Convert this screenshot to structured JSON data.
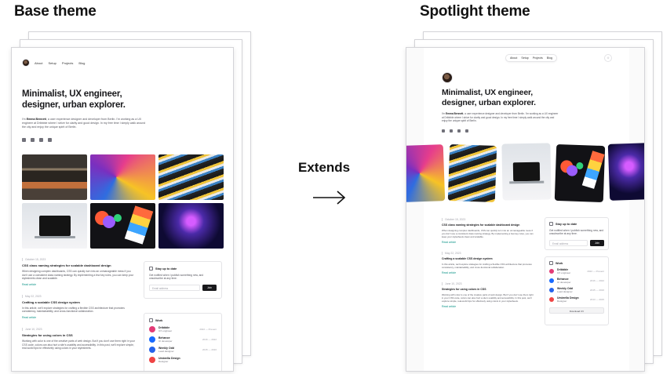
{
  "headings": {
    "base": "Base theme",
    "spotlight": "Spotlight theme",
    "relation": "Extends",
    "arrow_glyph": "→"
  },
  "site": {
    "nav": [
      "About",
      "Setup",
      "Projects",
      "Blog"
    ],
    "title": "Minimalist, UX engineer, designer, urban explorer.",
    "intro_prefix": "I'm ",
    "intro_name": "Emma Bennett",
    "intro_rest": ", a user experience designer and developer from Berlin. I'm working as a UX engineer at Dribbble where I strive for clarity and good design. In my free time I simply walk around the city and enjoy the unique spirit of Berlin.",
    "social_icons": [
      "twitter-icon",
      "instagram-icon",
      "github-icon",
      "linkedin-icon"
    ],
    "articles": [
      {
        "date": "October 15, 2023",
        "title": "CSS class naming strategies for scalable dashboard design",
        "body": "When designing complex dashboards, CSS can quickly turn into an unmanageable mess if you don't use a consistent class naming strategy. By implementing a few key rules, you can keep your stylesheets clean and scalable.",
        "link": "Read article"
      },
      {
        "date": "May 22, 2023",
        "title": "Crafting a scalable CSS design system",
        "body": "In this article, we'll explore strategies for crafting a flexible CSS architecture that promotes consistency, maintainability, and cross-functional collaboration.",
        "link": "Read article"
      },
      {
        "date": "June 10, 2023",
        "title": "Strategies for using colors in CSS",
        "body": "Working with color is one of the creative parts of web design. But if you don't use them right in your CSS code, colors can also hurt a site's usability and accessibility. In this post, we'll explore simple, real-world tips for effectively using colors in your stylesheets.",
        "link": "Read article"
      }
    ],
    "subscribe": {
      "title": "Stay up to date",
      "text": "Get notified when I publish something new, and unsubscribe at any time.",
      "placeholder": "Email address",
      "button": "Join"
    },
    "work": {
      "title": "Work",
      "items": [
        {
          "name": "Dribbble",
          "role": "UX engineer",
          "dates": "2022 — Present",
          "color": "#e33b76"
        },
        {
          "name": "Behance",
          "role": "UI developer",
          "dates": "2016 — 2022",
          "color": "#1769ff"
        },
        {
          "name": "Weekly Odd",
          "role": "Lead designer",
          "dates": "2015 — 2016",
          "color": "#2563eb"
        },
        {
          "name": "Umbrella Design",
          "role": "Designer",
          "dates": "2013 — 2015",
          "color": "#ef4444"
        }
      ],
      "download": "Download CV"
    }
  },
  "colors": {
    "accent": "#0d9488",
    "text": "#18181b",
    "muted": "#52525b",
    "border": "#e4e4e7"
  }
}
